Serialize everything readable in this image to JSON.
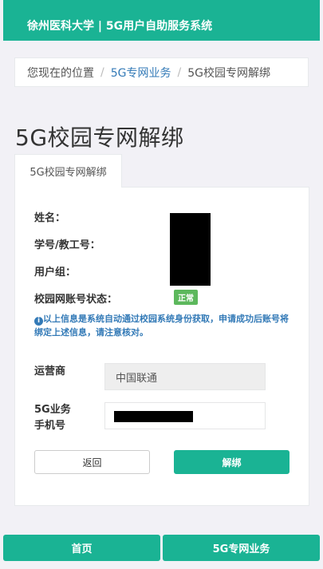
{
  "header": {
    "title": "徐州医科大学 | 5G用户自助服务系统"
  },
  "breadcrumb": {
    "prefix": "您现在的位置",
    "sep": "/",
    "items": [
      "5G专网业务",
      "5G校园专网解绑"
    ]
  },
  "page_title": "5G校园专网解绑",
  "tab_label": "5G校园专网解绑",
  "info": {
    "name_label": "姓名：",
    "id_label": "学号/教工号：",
    "group_label": "用户组：",
    "status_label": "校园网账号状态：",
    "status_badge": "正常",
    "notice": "以上信息是系统自动通过校园系统身份获取，申请成功后账号将绑定上述信息，请注意核对。"
  },
  "form": {
    "carrier_label": "运营商",
    "carrier_value": "中国联通",
    "phone_label_line1": "5G业务",
    "phone_label_line2": "手机号"
  },
  "buttons": {
    "back": "返回",
    "unbind": "解绑"
  },
  "footer": {
    "home": "首页",
    "service": "5G专网业务"
  },
  "colors": {
    "primary": "#1ab394",
    "link": "#337ab7",
    "badge": "#5cb85c"
  }
}
